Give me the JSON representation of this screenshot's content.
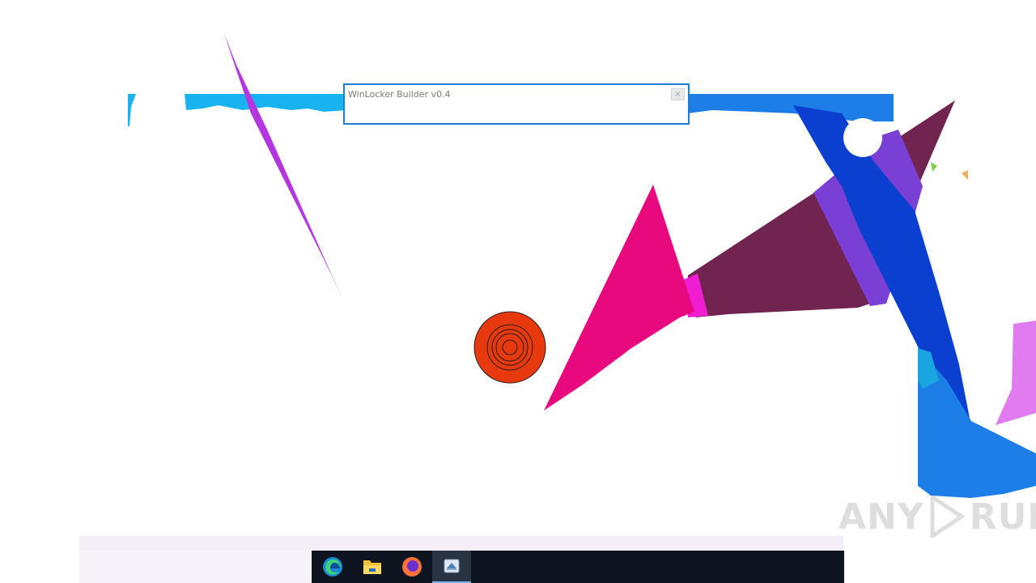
{
  "window": {
    "title": "WinLocker Builder v0.4",
    "close_glyph": "×"
  },
  "taskbar": {
    "items": [
      {
        "name": "edge-icon",
        "label": "Microsoft Edge"
      },
      {
        "name": "file-explorer-icon",
        "label": "File Explorer"
      },
      {
        "name": "firefox-icon",
        "label": "Firefox"
      },
      {
        "name": "winlocker-app-icon",
        "label": "WinLocker Builder",
        "active": true
      }
    ]
  },
  "watermark": {
    "left": "ANY",
    "right": "RUN"
  },
  "colors": {
    "taskbar": "#0f1520",
    "window_border": "#1b7fd6",
    "pink_triangle": "#e8097f",
    "maroon_shape": "#722450",
    "blue_shape": "#0a3fd0",
    "purple_streak": "#b436e0",
    "target_red": "#e8380d"
  }
}
